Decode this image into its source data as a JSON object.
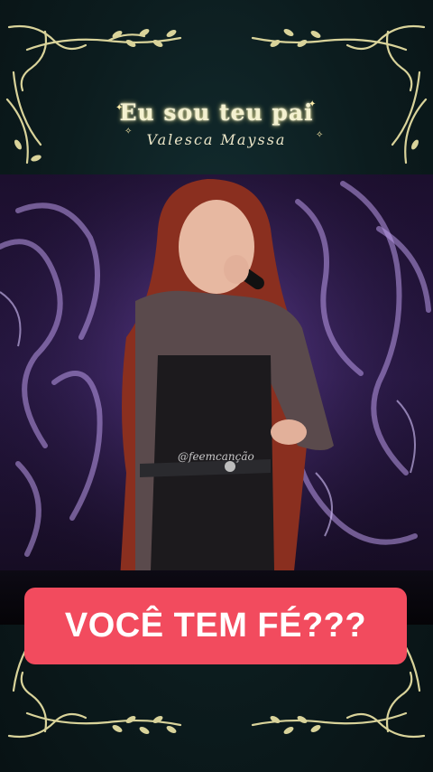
{
  "header": {
    "song_title": "Eu sou teu pai",
    "artist": "Valesca Mayssa"
  },
  "video": {
    "watermark": "@feemcanção",
    "caption": "VOCÊ TEM FÉ???"
  },
  "colors": {
    "background": "#0c1a1c",
    "ornament": "#d9d39a",
    "caption_bg": "#f24b5e",
    "stage_light": "#8a5cd6"
  },
  "icons": [
    "ornament-vine-icon",
    "sparkle-icon"
  ]
}
